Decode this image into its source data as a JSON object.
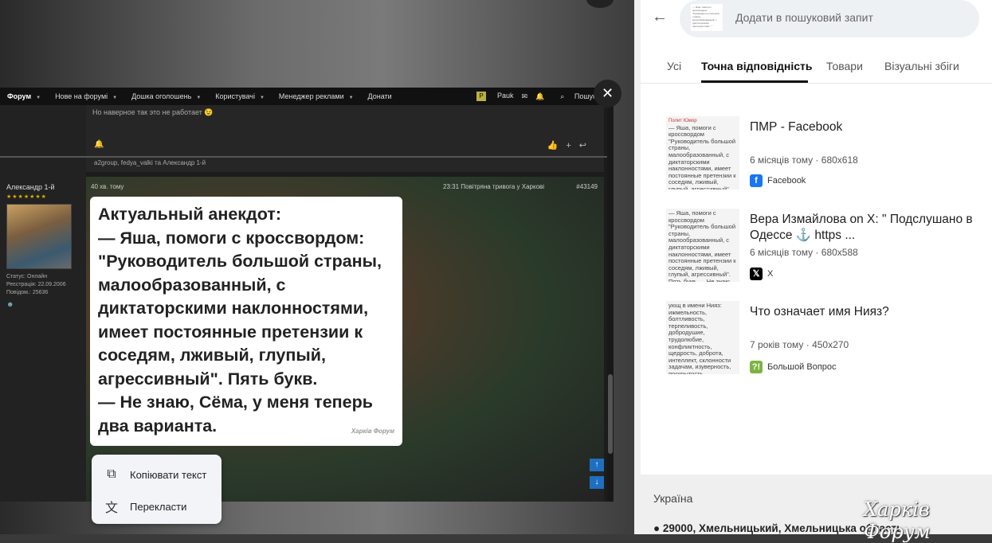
{
  "forum": {
    "nav": [
      {
        "label": "Форум"
      },
      {
        "label": "Нове на форумі"
      },
      {
        "label": "Дошка оголошень"
      },
      {
        "label": "Користувачі"
      },
      {
        "label": "Менеджер реклами"
      },
      {
        "label": "Донати"
      }
    ],
    "user_initial": "P",
    "user_name": "Pauk",
    "search_label": "Пошук",
    "post1_text": "Но наверное так это не работает 😉",
    "post1_likes": "a2group, fedya_valki та Александр 1-й",
    "post2_time": "40 хв. тому",
    "post2_alert": "23:31 Повітряна тривога у Харкові",
    "post2_number": "#43149",
    "author": {
      "name": "Александр 1-й",
      "stars": "★★★★★★★",
      "status": "Статус: Онлайн",
      "registered": "Реєстрація: 22.09.2006",
      "posts": "Повідом.: 25636"
    }
  },
  "meme": {
    "lines": [
      "Актуальный анекдот:",
      "— Яша, помоги с кроссвордом:",
      "\"Руководитель большой страны,",
      "малообразованный, с",
      "диктаторскими наклонностями,",
      "имеет постоянные претензии к",
      "соседям, лживый, глупый,",
      "агрессивный\". Пять букв.",
      "— Не знаю, Сёма, у меня теперь",
      "два варианта."
    ],
    "watermark": "Харків Форум"
  },
  "context_menu": {
    "copy_label": "Копіювати текст",
    "translate_label": "Перекласти"
  },
  "panel": {
    "search_placeholder": "Додати в пошуковий запит",
    "tabs": [
      "Усі",
      "Точна відповідність",
      "Товари",
      "Візуальні збіги"
    ],
    "active_tab": "Точна відповідність",
    "results": [
      {
        "title": "ПМР - Facebook",
        "age": "6 місяців тому",
        "size": "680x618",
        "source": "Facebook",
        "source_color": "#1877f2",
        "thumb_header": "Полит Юмор",
        "thumb_text": "— Яша, помоги с кроссвордом \"Руководитель большой страны, малообразованный, с диктаторскими наклонностями, имеет постоянные претензии к соседям, лживый, глупый, агрессивный\". Пять букв. — Не знаю, Сёма, у меня теперь два варианта."
      },
      {
        "title": "Вера Измайлова on X: \" Подслушано в Одессе ⚓ https ...",
        "age": "6 місяців тому",
        "size": "680x588",
        "source": "X",
        "source_color": "#000000",
        "thumb_header": "",
        "thumb_text": "— Яша, помоги с кроссвордом \"Руководитель большой страны, малообразованный, с диктаторскими наклонностями, имеет постоянные претензии к соседям, лживый, глупый, агрессивный\". Пять букв. — Не знаю, Сёма, у меня теперь два варианта."
      },
      {
        "title": "Что означает имя Нияз?",
        "age": "7 років тому",
        "size": "450x270",
        "source": "Большой Вопрос",
        "source_color": "#7cb342",
        "thumb_header": "",
        "thumb_text": "ующ в имени Нияз: ижмельность, болтливость, терпеливость, добродушие, трудолюбие, конфликтность, щедрость, доброта, интеллект, склонности задачам, изуверность, поскрытость, болтливость, терпеливость, способность к решению, творческие задачи, туп интуиции, интеллект, недостаток, трудолюбие, скрытость."
      }
    ],
    "footer_country": "Україна",
    "footer_location": "29000, Хмельницький, Хмельницька область"
  },
  "page_watermark": "Харків Форум"
}
